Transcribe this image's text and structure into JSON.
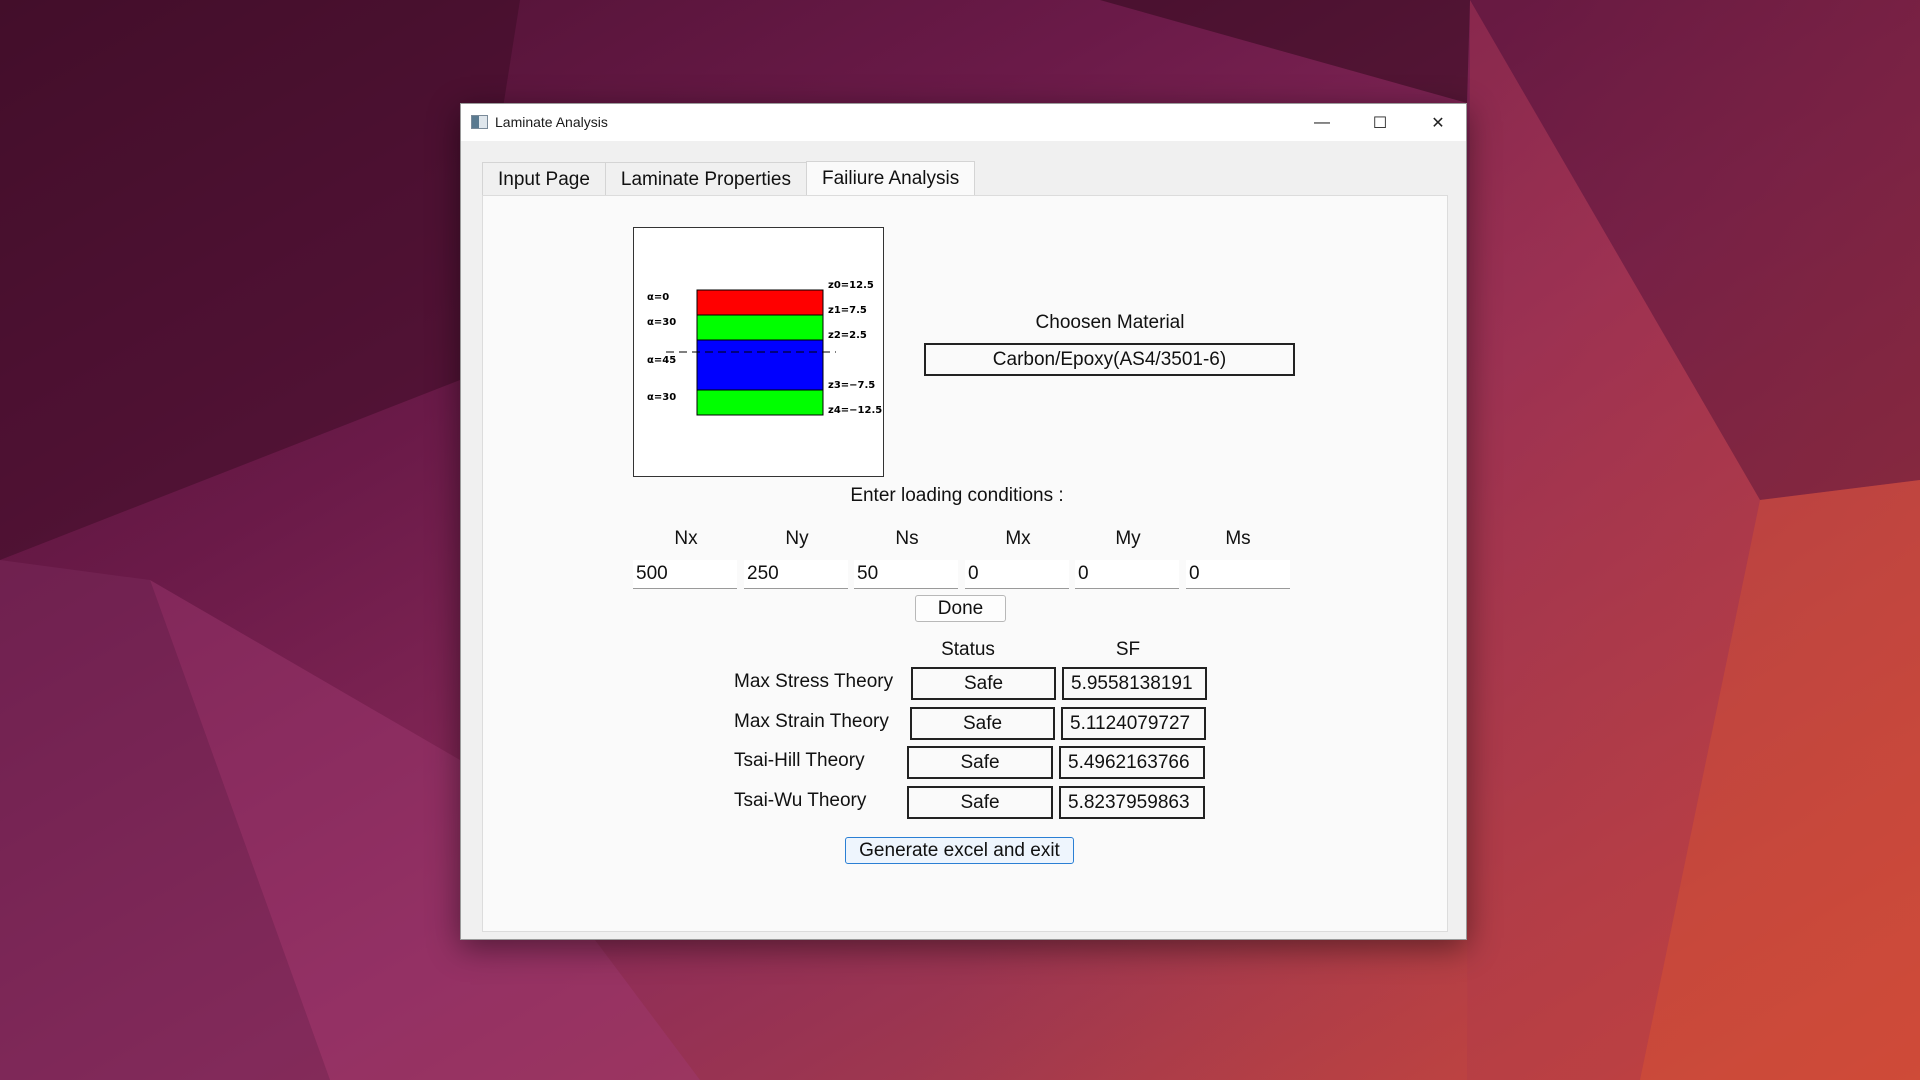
{
  "window": {
    "title": "Laminate Analysis",
    "controls": {
      "minimize": "—",
      "maximize": "☐",
      "close": "✕"
    }
  },
  "tabs": [
    {
      "label": "Input Page",
      "active": false
    },
    {
      "label": "Laminate Properties",
      "active": false
    },
    {
      "label": "Failiure Analysis",
      "active": true
    }
  ],
  "diagram": {
    "layers": [
      {
        "angle_label": "α=0",
        "color": "#ff0000"
      },
      {
        "angle_label": "α=30",
        "color": "#00ff00"
      },
      {
        "angle_label": "α=45",
        "color": "#0000ff"
      },
      {
        "angle_label": "α=30",
        "color": "#00ff00"
      }
    ],
    "z_labels": [
      "z0=12.5",
      "z1=7.5",
      "z2=2.5",
      "z3=−7.5",
      "z4=−12.5"
    ]
  },
  "material": {
    "heading": "Choosen Material",
    "value": "Carbon/Epoxy(AS4/3501-6)"
  },
  "loading": {
    "heading": "Enter loading conditions :",
    "fields": [
      {
        "label": "Nx",
        "value": "500"
      },
      {
        "label": "Ny",
        "value": "250"
      },
      {
        "label": "Ns",
        "value": "50"
      },
      {
        "label": "Mx",
        "value": "0"
      },
      {
        "label": "My",
        "value": "0"
      },
      {
        "label": "Ms",
        "value": "0"
      }
    ],
    "done_label": "Done"
  },
  "results": {
    "status_header": "Status",
    "sf_header": "SF",
    "rows": [
      {
        "theory": "Max Stress Theory",
        "status": "Safe",
        "sf": "5.9558138191"
      },
      {
        "theory": "Max Strain Theory",
        "status": "Safe",
        "sf": "5.1124079727"
      },
      {
        "theory": "Tsai-Hill Theory",
        "status": "Safe",
        "sf": "5.4962163766"
      },
      {
        "theory": "Tsai-Wu Theory",
        "status": "Safe",
        "sf": "5.8237959863"
      }
    ]
  },
  "generate_label": "Generate excel and exit"
}
